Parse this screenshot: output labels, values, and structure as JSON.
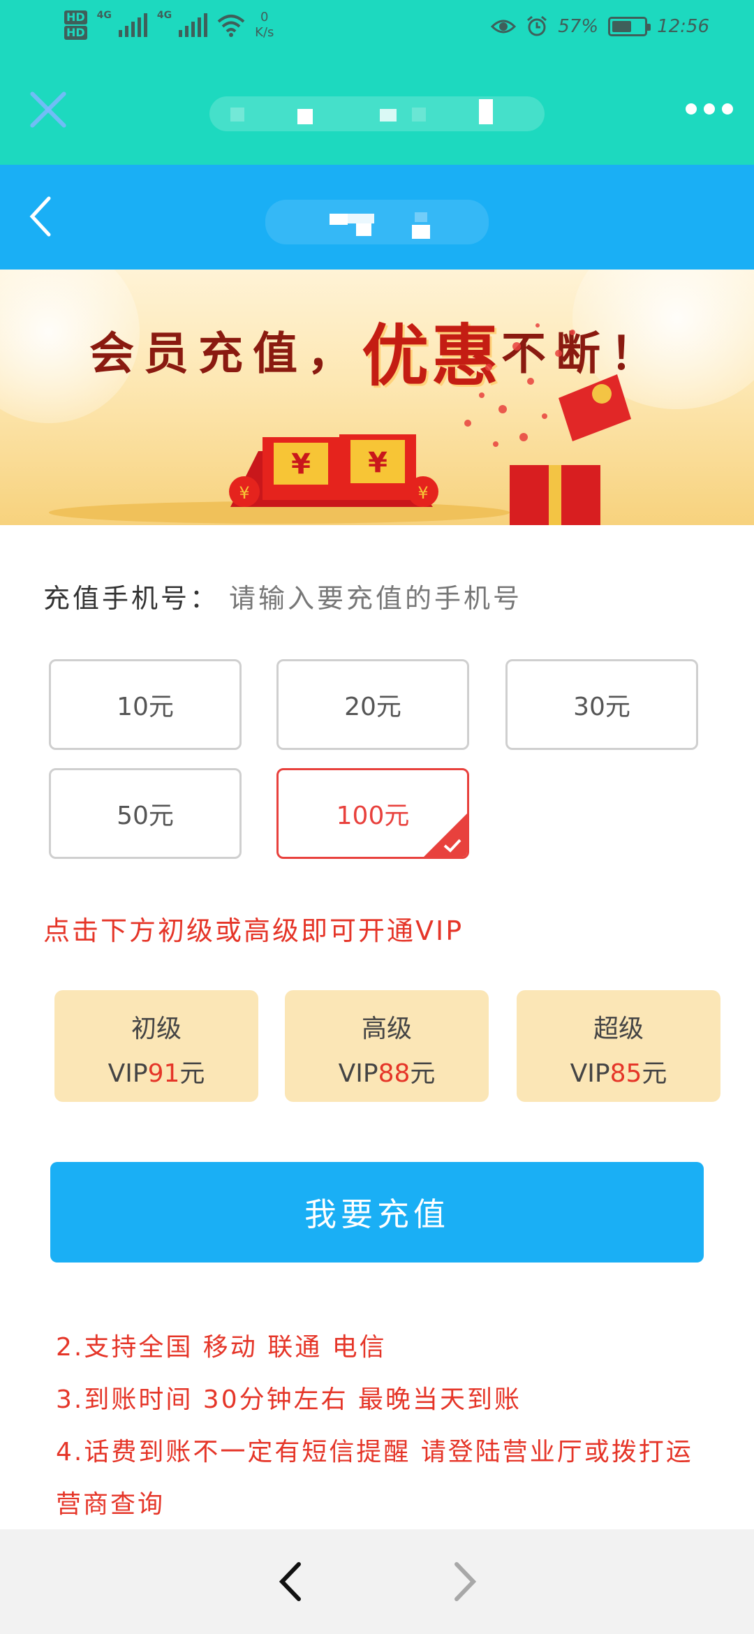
{
  "status_bar": {
    "hd1": "HD",
    "hd2": "HD",
    "net1": "4G",
    "net2": "4G",
    "speed_value": "0",
    "speed_unit": "K/s",
    "battery_text": "57%",
    "battery_level": 0.57,
    "time": "12:56"
  },
  "banner": {
    "part1": "会员充值，",
    "part2": "优惠",
    "part3": "不断！"
  },
  "form": {
    "phone_label": "充值手机号：",
    "phone_placeholder": "请输入要充值的手机号",
    "amounts": [
      {
        "label": "10元",
        "selected": false
      },
      {
        "label": "20元",
        "selected": false
      },
      {
        "label": "30元",
        "selected": false
      },
      {
        "label": "50元",
        "selected": false
      },
      {
        "label": "100元",
        "selected": true
      }
    ],
    "vip_hint": "点击下方初级或高级即可开通VIP",
    "vip_options": [
      {
        "title": "初级",
        "prefix": "VIP",
        "price": "91",
        "unit": "元"
      },
      {
        "title": "高级",
        "prefix": "VIP",
        "price": "88",
        "unit": "元"
      },
      {
        "title": "超级",
        "prefix": "VIP",
        "price": "85",
        "unit": "元"
      }
    ],
    "submit_label": "我要充值"
  },
  "notes": [
    "2.支持全国 移动 联通 电信",
    "3.到账时间 30分钟左右 最晚当天到账",
    "4.话费到账不一定有短信提醒 请登陆营业厅或拨打运营商查询"
  ],
  "colors": {
    "app_bar": "#1dd9bf",
    "nav_bar": "#1aaff5",
    "accent_red": "#e53528",
    "vip_bg": "#fbe6b6"
  }
}
